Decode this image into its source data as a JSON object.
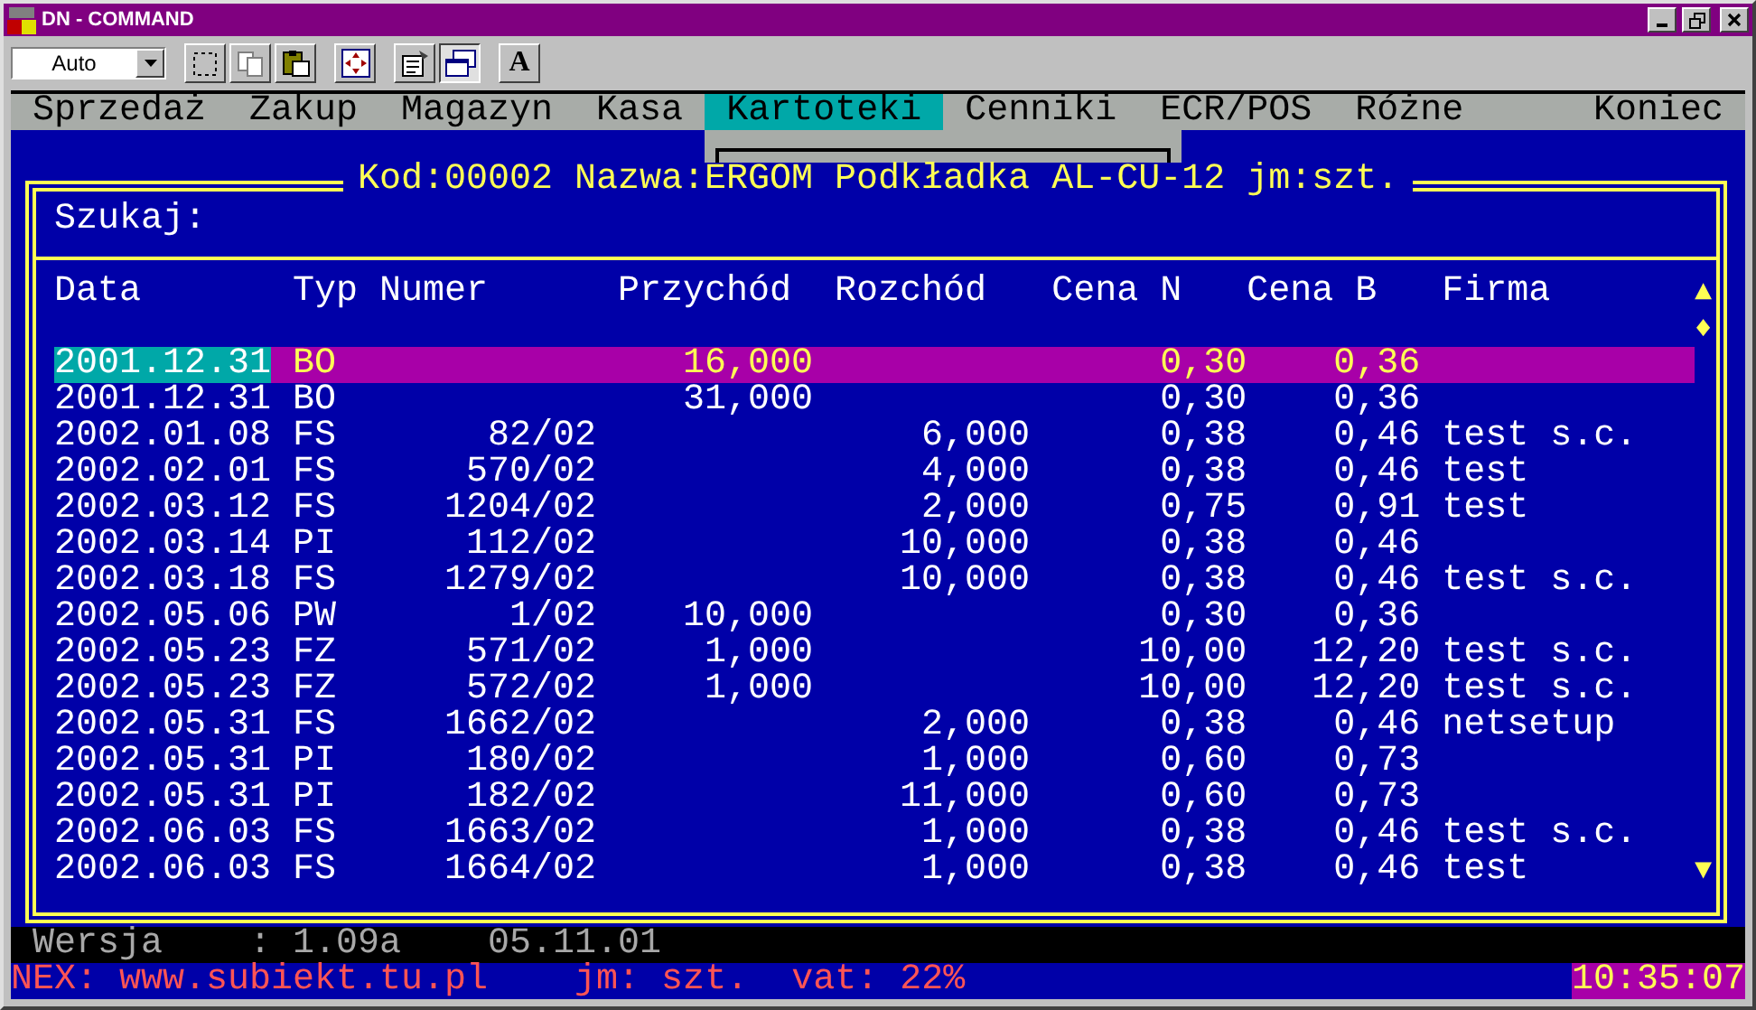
{
  "window": {
    "title": "DN - COMMAND"
  },
  "toolbar": {
    "font_size": "Auto",
    "font_button": "A",
    "buttons": [
      {
        "kind": "mark",
        "pressed": false
      },
      {
        "kind": "copy",
        "pressed": false
      },
      {
        "kind": "paste",
        "pressed": false
      },
      {
        "kind": "fullscreen",
        "pressed": false
      },
      {
        "kind": "properties",
        "pressed": false
      },
      {
        "kind": "background",
        "pressed": true
      }
    ]
  },
  "menu": [
    {
      "label": "Sprzedaż",
      "selected": false
    },
    {
      "label": "Zakup",
      "selected": false
    },
    {
      "label": "Magazyn",
      "selected": false
    },
    {
      "label": "Kasa",
      "selected": false
    },
    {
      "label": "Kartoteki",
      "selected": true
    },
    {
      "label": "Cenniki",
      "selected": false
    },
    {
      "label": "ECR/POS",
      "selected": false
    },
    {
      "label": "Różne",
      "selected": false
    }
  ],
  "menu_end": {
    "label": "Koniec",
    "selected": false
  },
  "panel": {
    "title": "Kod:00002 Nazwa:ERGOM Podkładka AL-CU-12 jm:szt.",
    "search_label": "Szukaj:",
    "columns": [
      "Data",
      "Typ",
      "Numer",
      "Przychód",
      "Rozchód",
      "Cena N",
      "Cena B",
      "Firma"
    ],
    "scroll": {
      "up": "▲",
      "thumb": "♦",
      "down": "▼"
    },
    "rows": [
      {
        "date": "2001.12.31",
        "type": "BO",
        "number": "",
        "income": "16,000",
        "outcome": "",
        "price_net": "0,30",
        "price_gross": "0,36",
        "company": "",
        "selected": true
      },
      {
        "date": "2001.12.31",
        "type": "BO",
        "number": "",
        "income": "31,000",
        "outcome": "",
        "price_net": "0,30",
        "price_gross": "0,36",
        "company": "",
        "selected": false
      },
      {
        "date": "2002.01.08",
        "type": "FS",
        "number": "82/02",
        "income": "",
        "outcome": "6,000",
        "price_net": "0,38",
        "price_gross": "0,46",
        "company": "test s.c.",
        "selected": false
      },
      {
        "date": "2002.02.01",
        "type": "FS",
        "number": "570/02",
        "income": "",
        "outcome": "4,000",
        "price_net": "0,38",
        "price_gross": "0,46",
        "company": "test",
        "selected": false
      },
      {
        "date": "2002.03.12",
        "type": "FS",
        "number": "1204/02",
        "income": "",
        "outcome": "2,000",
        "price_net": "0,75",
        "price_gross": "0,91",
        "company": "test",
        "selected": false
      },
      {
        "date": "2002.03.14",
        "type": "PI",
        "number": "112/02",
        "income": "",
        "outcome": "10,000",
        "price_net": "0,38",
        "price_gross": "0,46",
        "company": "",
        "selected": false
      },
      {
        "date": "2002.03.18",
        "type": "FS",
        "number": "1279/02",
        "income": "",
        "outcome": "10,000",
        "price_net": "0,38",
        "price_gross": "0,46",
        "company": "test s.c.",
        "selected": false
      },
      {
        "date": "2002.05.06",
        "type": "PW",
        "number": "1/02",
        "income": "10,000",
        "outcome": "",
        "price_net": "0,30",
        "price_gross": "0,36",
        "company": "",
        "selected": false
      },
      {
        "date": "2002.05.23",
        "type": "FZ",
        "number": "571/02",
        "income": "1,000",
        "outcome": "",
        "price_net": "10,00",
        "price_gross": "12,20",
        "company": "test s.c.",
        "selected": false
      },
      {
        "date": "2002.05.23",
        "type": "FZ",
        "number": "572/02",
        "income": "1,000",
        "outcome": "",
        "price_net": "10,00",
        "price_gross": "12,20",
        "company": "test s.c.",
        "selected": false
      },
      {
        "date": "2002.05.31",
        "type": "FS",
        "number": "1662/02",
        "income": "",
        "outcome": "2,000",
        "price_net": "0,38",
        "price_gross": "0,46",
        "company": "netsetup",
        "selected": false
      },
      {
        "date": "2002.05.31",
        "type": "PI",
        "number": "180/02",
        "income": "",
        "outcome": "1,000",
        "price_net": "0,60",
        "price_gross": "0,73",
        "company": "",
        "selected": false
      },
      {
        "date": "2002.05.31",
        "type": "PI",
        "number": "182/02",
        "income": "",
        "outcome": "11,000",
        "price_net": "0,60",
        "price_gross": "0,73",
        "company": "",
        "selected": false
      },
      {
        "date": "2002.06.03",
        "type": "FS",
        "number": "1663/02",
        "income": "",
        "outcome": "1,000",
        "price_net": "0,38",
        "price_gross": "0,46",
        "company": "test s.c.",
        "selected": false
      },
      {
        "date": "2002.06.03",
        "type": "FS",
        "number": "1664/02",
        "income": "",
        "outcome": "1,000",
        "price_net": "0,38",
        "price_gross": "0,46",
        "company": "test",
        "selected": false
      }
    ]
  },
  "version_line": "Wersja    : 1.09a    05.11.01",
  "status_bar": {
    "text": "NEX: www.subiekt.tu.pl    jm: szt.  vat: 22%",
    "clock": "10:35:07"
  }
}
